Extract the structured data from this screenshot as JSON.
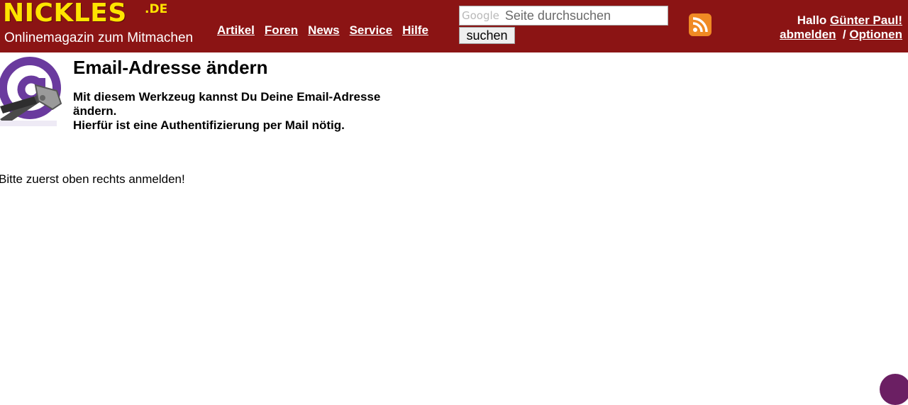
{
  "header": {
    "logo_main": "NICKLES",
    "logo_tld": ".DE",
    "logo_sub": "Onlinemagazin zum Mitmachen",
    "nav": [
      "Artikel",
      "Foren",
      "News",
      "Service",
      "Hilfe"
    ],
    "search": {
      "google_mark": "Google",
      "placeholder": "Seite durchsuchen",
      "button_label": "suchen"
    },
    "rss_icon": "rss-feed-icon",
    "user": {
      "greeting": "Hallo",
      "name": "Günter Paul!",
      "logout": "abmelden",
      "separator": "/",
      "options": "Optionen"
    }
  },
  "content": {
    "icon": "at-sign-with-pliers-icon",
    "title": "Email-Adresse ändern",
    "intro_line1": "Mit diesem Werkzeug kannst Du Deine Email-Adresse ändern.",
    "intro_line2": "Hierfür ist eine Authentifizierung per Mail nötig.",
    "notice": "Bitte zuerst oben rechts anmelden!"
  },
  "colors": {
    "header_bg": "#8b1414",
    "logo_yellow": "#ffe400",
    "rss_orange": "#f08a24",
    "at_purple": "#6a3a9e"
  }
}
